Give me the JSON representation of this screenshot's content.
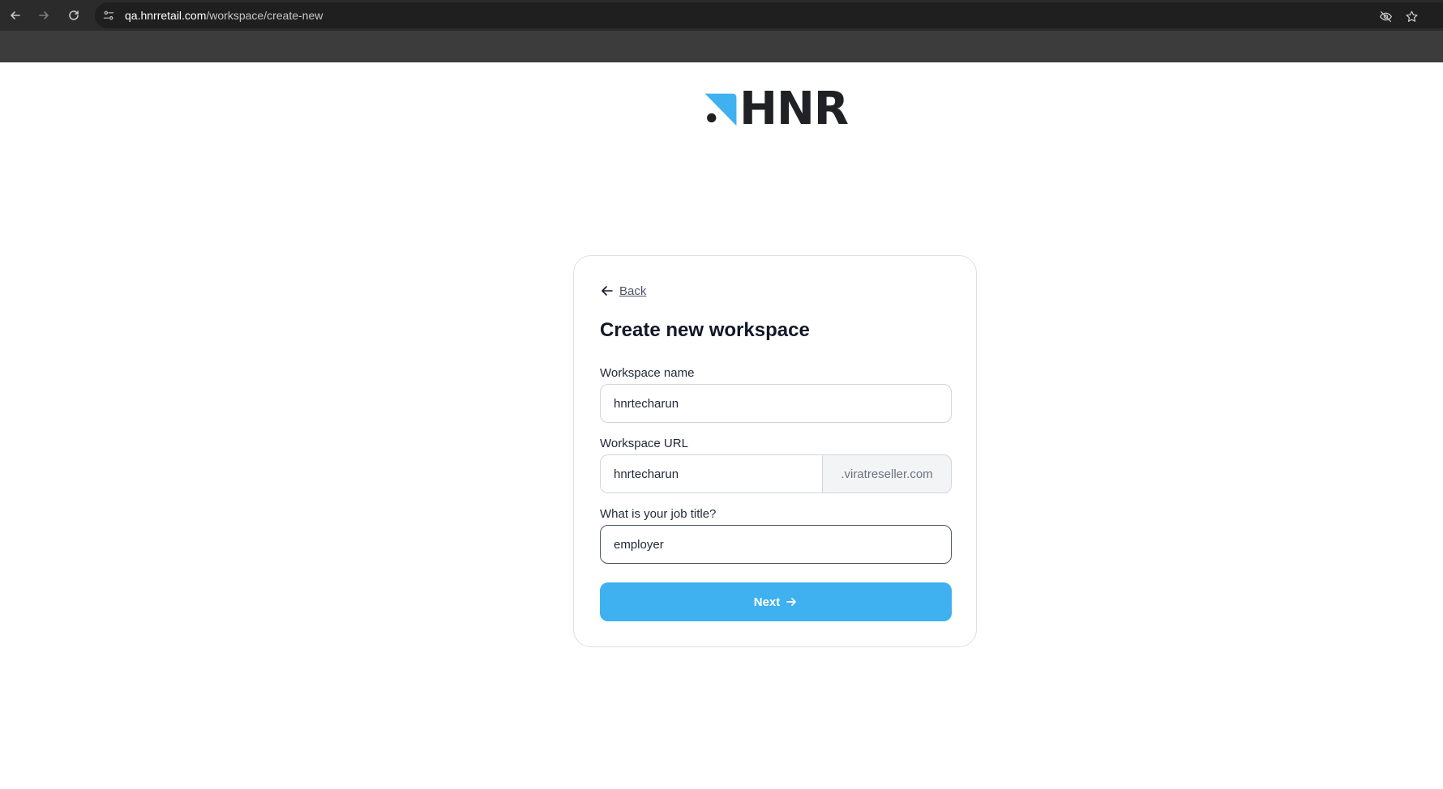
{
  "browser": {
    "url_host": "qa.hnrretail.com",
    "url_path": "/workspace/create-new",
    "icons": [
      "back-icon",
      "forward-icon",
      "reload-icon",
      "site-settings-icon",
      "eye-off-icon",
      "bookmark-star-icon"
    ]
  },
  "logo": {
    "word": "HNR",
    "accent_color": "#3fb0f0"
  },
  "form": {
    "back_label": "Back",
    "title": "Create new workspace",
    "workspace_name": {
      "label": "Workspace name",
      "value": "hnrtecharun"
    },
    "workspace_url": {
      "label": "Workspace URL",
      "value": "hnrtecharun",
      "suffix": ".viratreseller.com"
    },
    "job_title": {
      "label": "What is your job title?",
      "value": "employer"
    },
    "next_label": "Next"
  },
  "colors": {
    "primary": "#3fb0f0",
    "chrome_bg": "#3c3c3c",
    "omnibox_bg": "#1f1f1f"
  }
}
